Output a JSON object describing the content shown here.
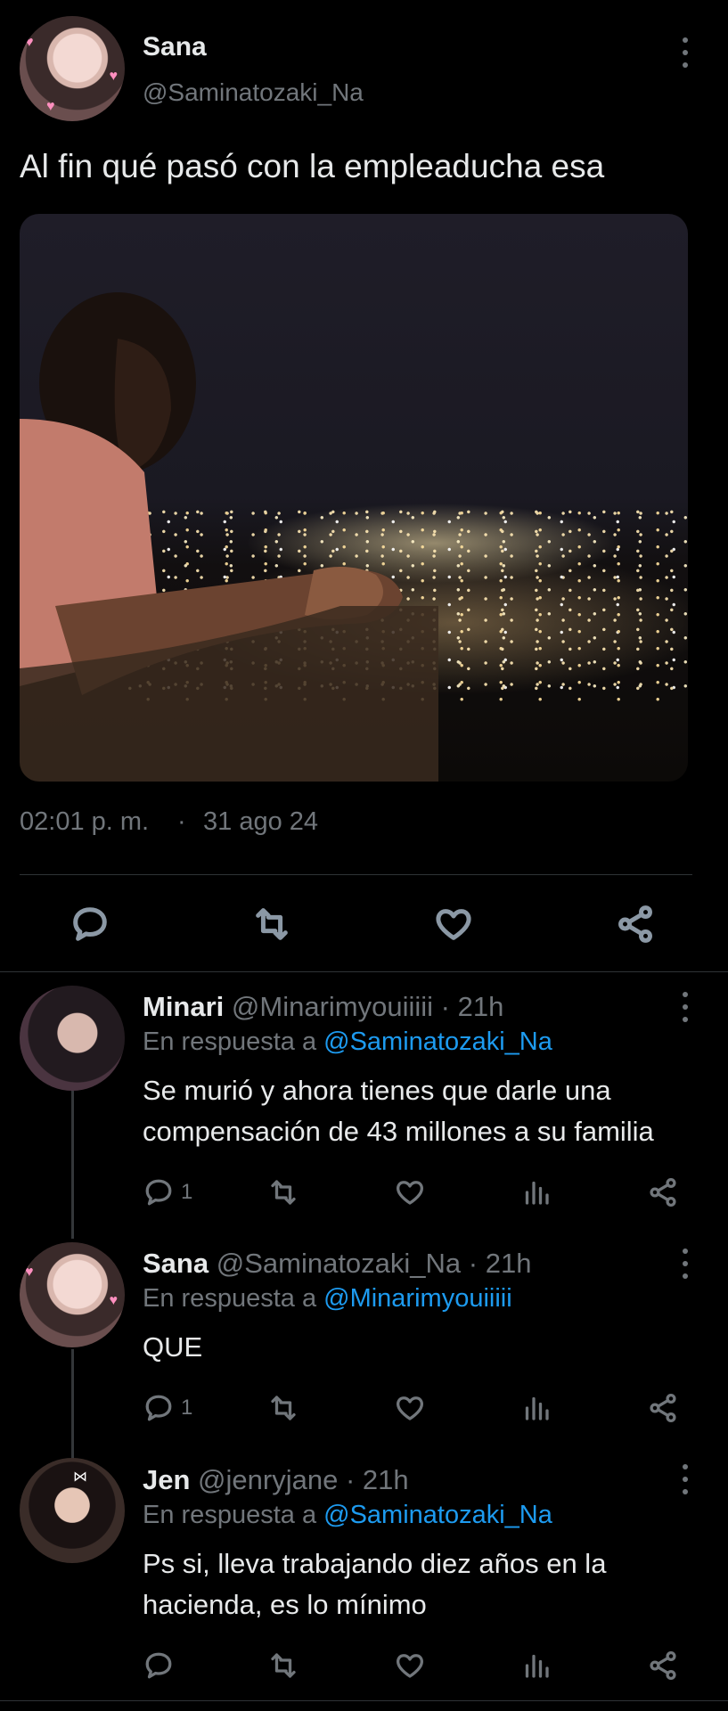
{
  "main_tweet": {
    "author_name": "Sana",
    "handle": "@Saminatozaki_Na",
    "text": "Al fin qué pasó con la empleaducha esa",
    "time": "02:01 p. m.",
    "separator": "·",
    "date": "31 ago 24"
  },
  "replies": [
    {
      "author_name": "Minari",
      "handle": "@Minarimyouiiiii",
      "time": "· 21h",
      "reply_prefix": "En respuesta a",
      "reply_to": "@Saminatozaki_Na",
      "text_lines": [
        "Se murió y ahora tienes que darle una",
        "compensación de 43 millones a su familia"
      ],
      "reply_count": "1"
    },
    {
      "author_name": "Sana",
      "handle": "@Saminatozaki_Na",
      "time": "· 21h",
      "reply_prefix": "En respuesta a",
      "reply_to": "@Minarimyouiiiii",
      "text_lines": [
        "QUE"
      ],
      "reply_count": "1"
    },
    {
      "author_name": "Jen",
      "handle": "@jenryjane",
      "time": "· 21h",
      "reply_prefix": "En respuesta a",
      "reply_to": "@Saminatozaki_Na",
      "text_lines": [
        "Ps si, lleva trabajando diez años en la",
        "hacienda, es lo mínimo"
      ],
      "reply_count": ""
    }
  ],
  "icons": {
    "reply": "reply-icon",
    "retweet": "retweet-icon",
    "like": "heart-icon",
    "views": "views-icon",
    "share": "share-icon",
    "more": "more-icon"
  },
  "colors": {
    "background": "#000000",
    "text": "#e7e9ea",
    "muted": "#71767b",
    "link": "#1d9bf0"
  }
}
